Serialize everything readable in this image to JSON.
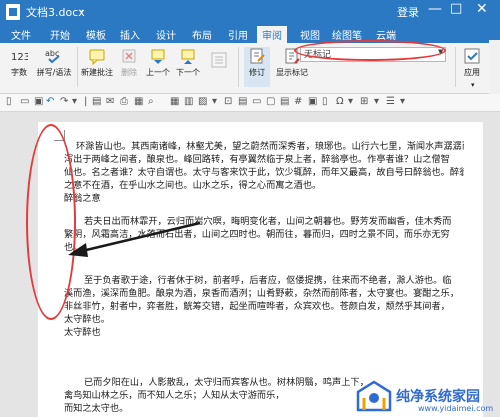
{
  "window": {
    "title": "文档3.docx",
    "login": "登录",
    "controls": {
      "minimize": "—",
      "maximize": "□",
      "close": "✕"
    }
  },
  "tabs": [
    "文件",
    "开始",
    "模板",
    "插入",
    "设计",
    "布局",
    "引用",
    "审阅",
    "视图",
    "绘图笔",
    "云端"
  ],
  "active_tab": "审阅",
  "ribbon": {
    "word_count": "字数",
    "spelling": "拼写/语法",
    "new_comment": "新建批注",
    "delete": "删除",
    "prev_comment": "上一个",
    "next_comment": "下一个",
    "track_changes": "修订",
    "show_markup": "显示标记",
    "markup_select": "无标记",
    "apply": "应用"
  },
  "document": {
    "paragraphs": [
      [
        "环滁皆山也。其西南诸峰，林壑尤美，望之蔚然而深秀者，琅琊也。山行六七里，渐闻水声潺潺而",
        "泻出于两峰之间者，酿泉也。峰回路转，有亭翼然临于泉上者，醉翁亭也。作亭者谁？山之僧智",
        "仙也。名之者谁？太守自谓也。太守与客来饮于此，饮少辄醉，而年又最高，故自号曰醉翁也。醉翁",
        "之意不在酒，在乎山水之间也。山水之乐，得之心而寓之酒也。",
        "醉翁之意"
      ],
      [
        "若夫日出而林霏开，云归而岩穴暝，晦明变化者，山间之朝暮也。野芳发而幽香，佳木秀而",
        "繁阴，风霜高洁，水落而石出者，山间之四时也。朝而往，暮而归，四时之景不同，而乐亦无穷",
        "也。"
      ],
      [
        "至于负者歌于途，行者休于树，前者呼，后者应，伛偻提携，往来而不绝者，滁人游也。临",
        "溪而渔，溪深而鱼肥。酿泉为酒，泉香而酒洌；山肴野蔌，杂然而前陈者，太守宴也。宴酣之乐，",
        "非丝非竹，射者中，弈者胜，觥筹交错，起坐而喧哗者，众宾欢也。苍颜白发，颓然乎其间者，",
        "太守醉也。",
        "太守醉也"
      ],
      [
        "已而夕阳在山，人影散乱，太守归而宾客从也。树林阴翳，鸣声上下，",
        "禽鸟知山林之乐，而不知人之乐；人知从太守游而乐，",
        "而知之太守也。"
      ]
    ]
  },
  "watermark": {
    "text": "纯净系统家园",
    "url": "www.yidaimei.com"
  }
}
